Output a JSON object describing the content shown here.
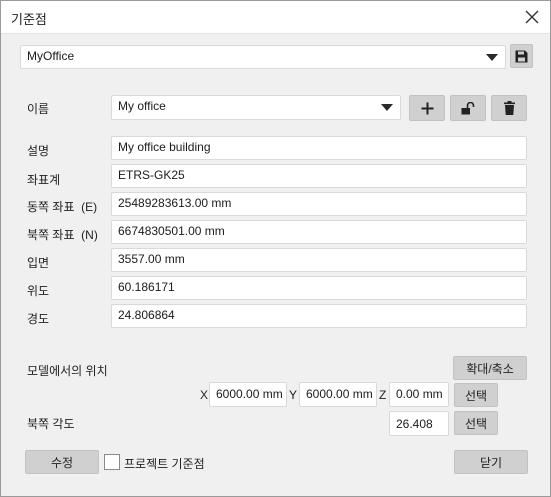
{
  "window": {
    "title": "기준점",
    "close_icon": "close-icon"
  },
  "profile": {
    "selected": "MyOffice",
    "save_icon": "floppy-disk-icon"
  },
  "name": {
    "label": "이름",
    "value": "My office",
    "add_icon": "plus-icon",
    "lock_icon": "unlock-icon",
    "delete_icon": "trash-icon"
  },
  "fields": [
    {
      "label": "설명",
      "value": "My office building"
    },
    {
      "label": "좌표계",
      "value": "ETRS-GK25"
    },
    {
      "label": "동쪽 좌표  (E)",
      "value": "25489283613.00 mm"
    },
    {
      "label": "북쪽 좌표  (N)",
      "value": "6674830501.00 mm"
    },
    {
      "label": "입면",
      "value": "3557.00 mm"
    },
    {
      "label": "위도",
      "value": "60.186171"
    },
    {
      "label": "경도",
      "value": "24.806864"
    }
  ],
  "model_position": {
    "label": "모델에서의 위치",
    "zoom_button": "확대/축소",
    "x_label": "X",
    "x_value": "6000.00 mm",
    "y_label": "Y",
    "y_value": "6000.00 mm",
    "z_label": "Z",
    "z_value": "0.00 mm",
    "select_button": "선택"
  },
  "north_angle": {
    "label": "북쪽 각도",
    "value": "26.408",
    "select_button": "선택"
  },
  "footer": {
    "edit_button": "수정",
    "project_checkbox_label": "프로젝트 기준점",
    "project_checked": false,
    "close_button": "닫기"
  }
}
